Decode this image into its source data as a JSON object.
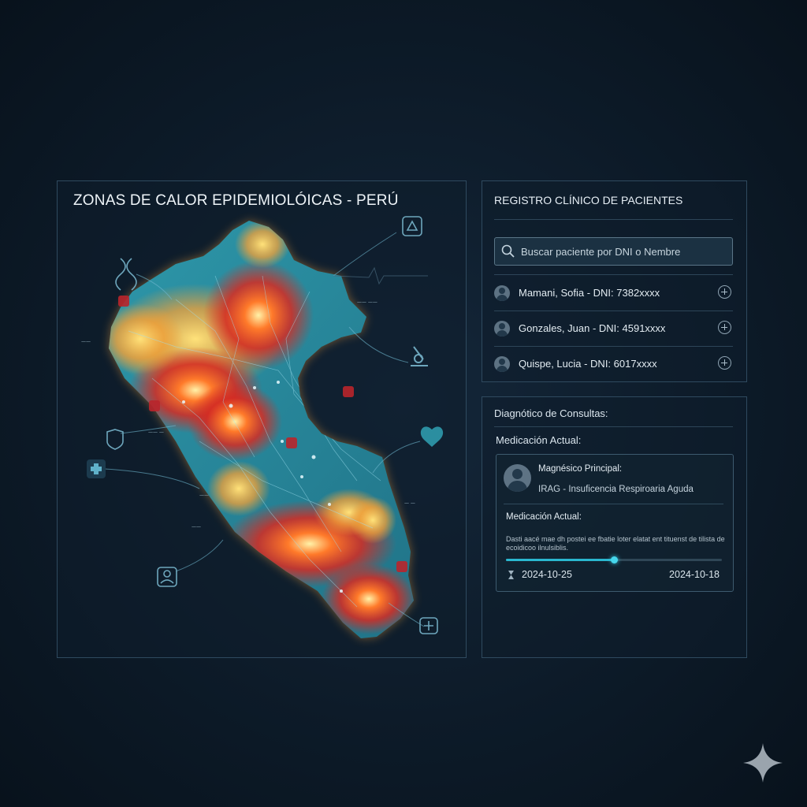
{
  "map": {
    "title": "ZONAS DE CALOR EPIDEMIOLÓICAS - PERÚ",
    "colors": {
      "land": "#2b8ea0",
      "hot": "#e0362b",
      "warm": "#f2a43a",
      "edge": "#ffd36b",
      "line": "#7fc8e0"
    },
    "icons": [
      "dna-icon",
      "recycle-icon",
      "microscope-icon",
      "heart-pulse-icon",
      "medical-cross-icon",
      "shield-icon",
      "doctor-icon",
      "first-aid-icon",
      "capsule-icon"
    ]
  },
  "registry": {
    "title": "REGISTRO CLÍNICO DE PACIENTES",
    "search_placeholder": "Buscar paciente por DNI o Nembre",
    "patients": [
      {
        "name": "Mamani, Sofia - DNI: 7382xxxx"
      },
      {
        "name": "Gonzales, Juan - DNI: 4591xxxx"
      },
      {
        "name": "Quispe, Lucia - DNI: 6017xxxx"
      }
    ]
  },
  "diagnosis": {
    "title": "Diagnótico de Consultas:",
    "medication_heading": "Medicación Actual:",
    "card": {
      "label": "Magnésico Principal:",
      "value": "IRAG - Insuficencia Respiroaria Aguda",
      "medication_label": "Medicación Actual:",
      "description": "Dasti aacé mae dh postei ee fbatie loter elatat ent tituenst de tilista de ecoidicoo ilnulsiblis.",
      "progress": 0.5,
      "start_date": "2024-10-25",
      "end_date": "2024-10-18"
    }
  },
  "accent_color": "#2ab7cf"
}
